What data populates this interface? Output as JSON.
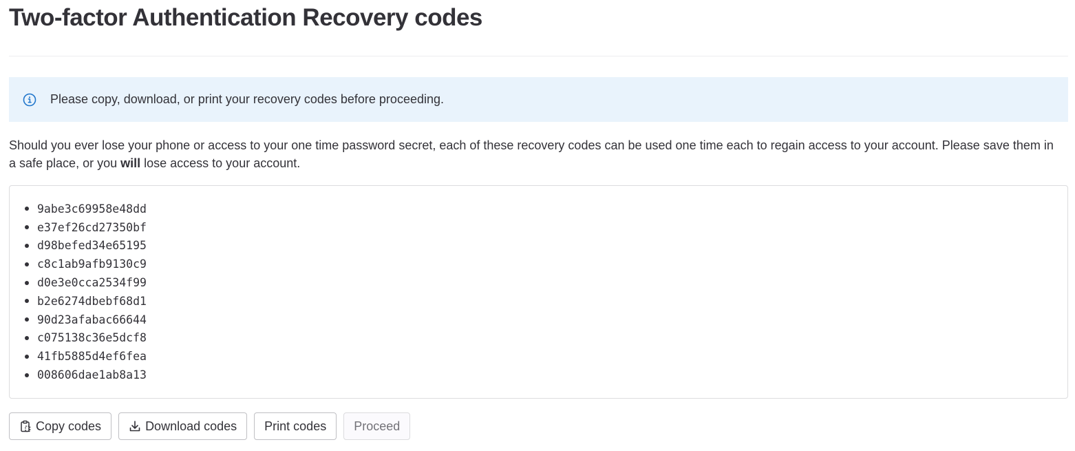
{
  "page": {
    "title": "Two-factor Authentication Recovery codes"
  },
  "alert": {
    "icon": "info-icon",
    "text": "Please copy, download, or print your recovery codes before proceeding.",
    "color": "#1f75cb",
    "background": "#e9f3fc"
  },
  "description": {
    "part1": "Should you ever lose your phone or access to your one time password secret, each of these recovery codes can be used one time each to regain access to your account. Please save them in a safe place, or you ",
    "emphasis": "will",
    "part2": " lose access to your account."
  },
  "codes": [
    "9abe3c69958e48dd",
    "e37ef26cd27350bf",
    "d98befed34e65195",
    "c8c1ab9afb9130c9",
    "d0e3e0cca2534f99",
    "b2e6274dbebf68d1",
    "90d23afabac66644",
    "c075138c36e5dcf8",
    "41fb5885d4ef6fea",
    "008606dae1ab8a13"
  ],
  "actions": {
    "copy": {
      "label": "Copy codes",
      "icon": "clipboard-icon"
    },
    "download": {
      "label": "Download codes",
      "icon": "download-icon"
    },
    "print": {
      "label": "Print codes"
    },
    "proceed": {
      "label": "Proceed",
      "disabled": true
    }
  }
}
